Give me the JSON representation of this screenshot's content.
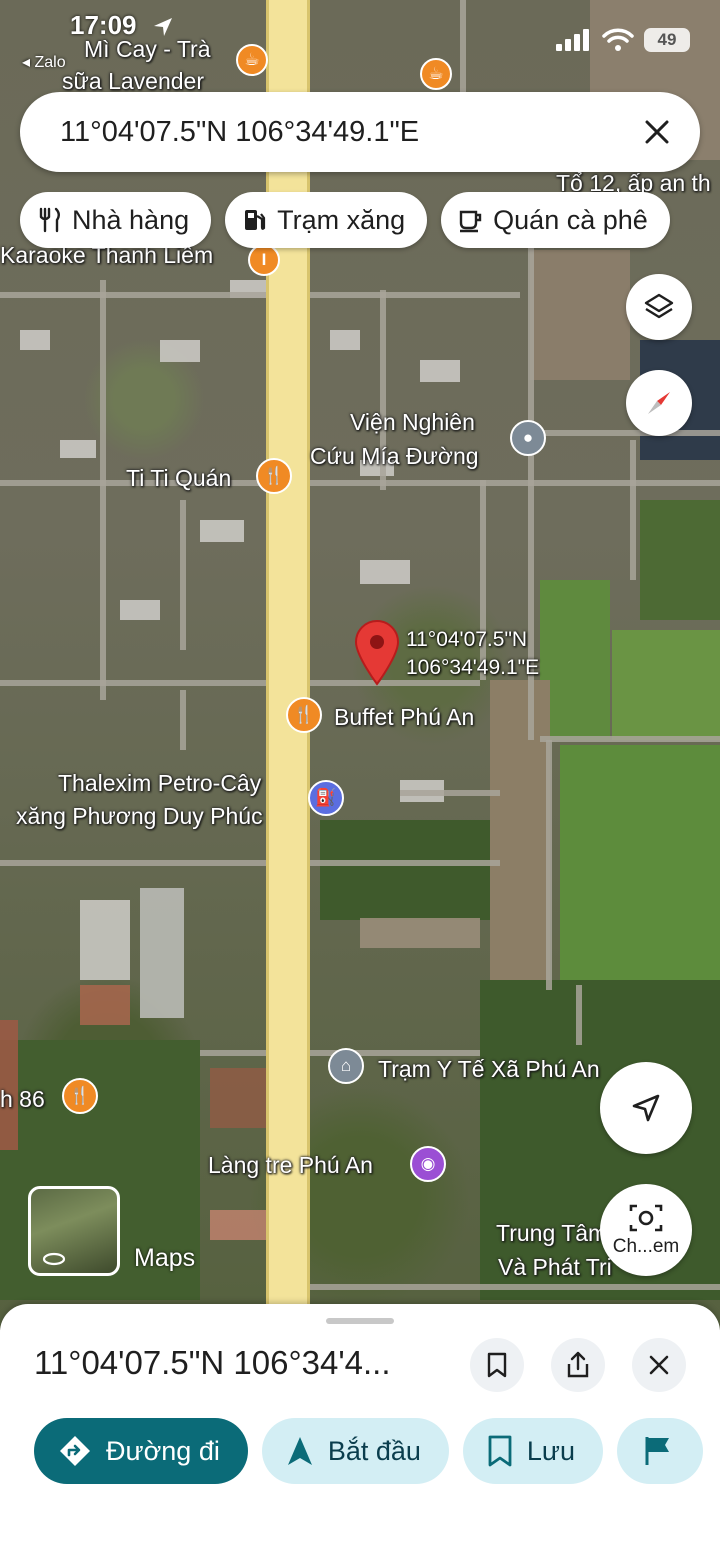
{
  "status_bar": {
    "time": "17:09",
    "back_app": "◂ Zalo",
    "battery": "49"
  },
  "search": {
    "query": "11°04'07.5\"N 106°34'49.1\"E"
  },
  "chips": [
    {
      "label": "Nhà hàng",
      "icon": "restaurant-icon"
    },
    {
      "label": "Trạm xăng",
      "icon": "gas-station-icon"
    },
    {
      "label": "Quán cà phê",
      "icon": "coffee-icon"
    }
  ],
  "map": {
    "labels": {
      "mi_cay_1": "Mì Cay - Trà",
      "mi_cay_2": "sữa Lavender",
      "to12": "Tổ 12, ấp an th",
      "karaoke": "Karaoke Thanh Liêm",
      "vien_1": "Viện Nghiên",
      "vien_2": "Cứu Mía Đường",
      "titi": "Ti Ti Quán",
      "pin_1": "11°04'07.5\"N",
      "pin_2": "106°34'49.1\"E",
      "buffet": "Buffet Phú An",
      "thalexim_1": "Thalexim Petro-Cây",
      "thalexim_2": "xăng Phương Duy Phúc",
      "tram_yte": "Trạm Y Tế Xã Phú An",
      "h86": "h 86",
      "lang_tre": "Làng tre Phú An",
      "trung_tam_1": "Trung Tâm",
      "trung_tam_2": "Và Phát Tri",
      "maps": "Maps",
      "search_here": "Ch...em"
    }
  },
  "sheet": {
    "title": "11°04'07.5\"N 106°34'4...",
    "actions": [
      {
        "label": "Đường đi",
        "icon": "directions-icon"
      },
      {
        "label": "Bắt đầu",
        "icon": "navigation-arrow-icon"
      },
      {
        "label": "Lưu",
        "icon": "bookmark-icon"
      }
    ]
  },
  "colors": {
    "accent": "#0b6b78",
    "chip_action": "#d3eef4",
    "highway": "#f3e39a",
    "pin": "#e53935"
  }
}
